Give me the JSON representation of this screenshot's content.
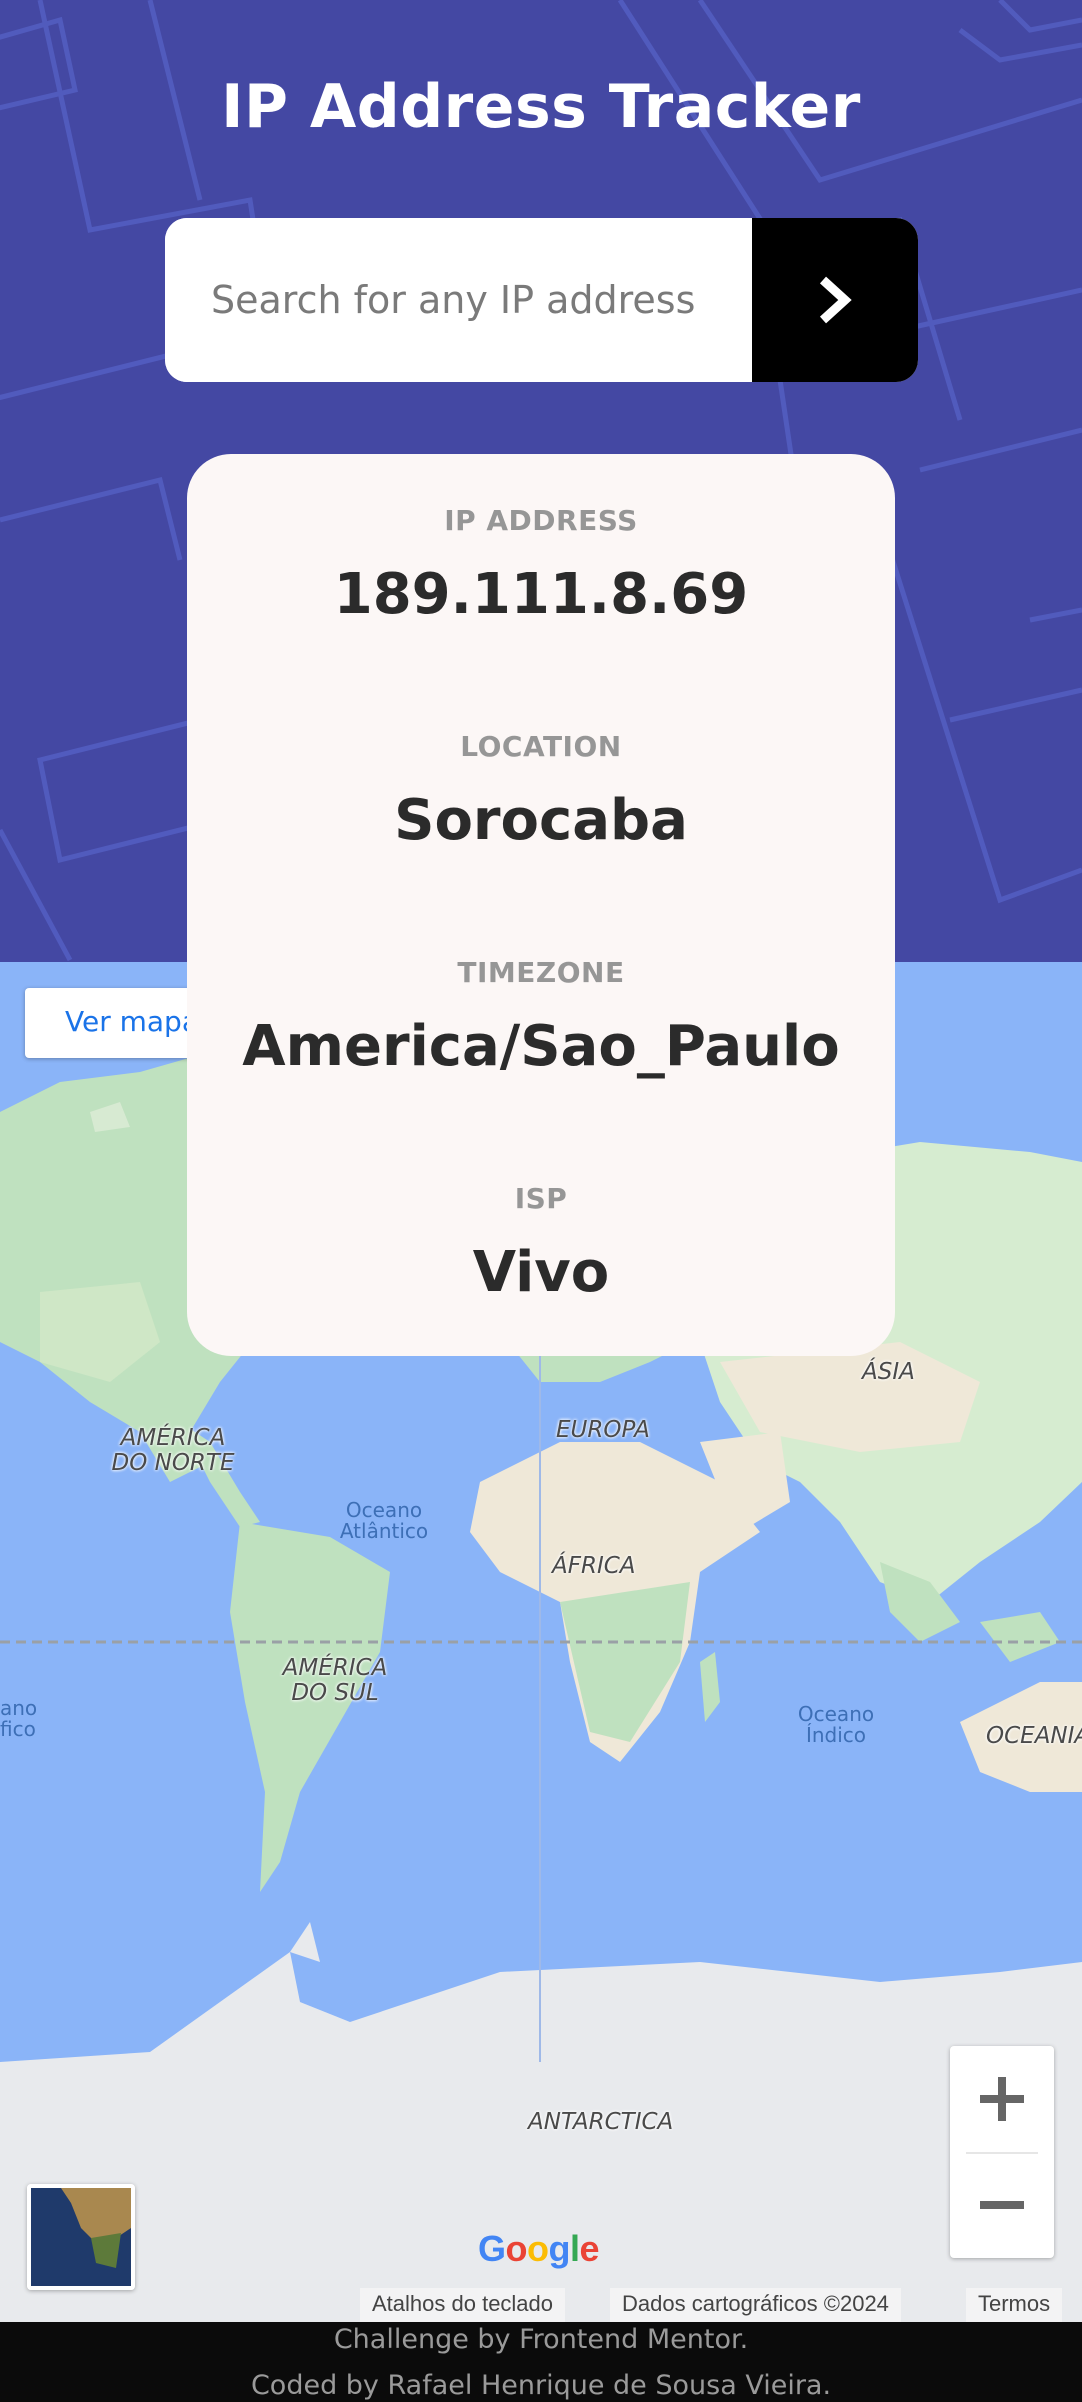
{
  "header": {
    "title": "IP Address Tracker"
  },
  "search": {
    "placeholder": "Search for any IP address",
    "submit_icon": "chevron-right-icon"
  },
  "info": {
    "ip_label": "IP ADDRESS",
    "ip_value": "189.111.8.69",
    "location_label": "LOCATION",
    "location_value": "Sorocaba",
    "timezone_label": "TIMEZONE",
    "timezone_value": "America/Sao_Paulo",
    "isp_label": "ISP",
    "isp_value": "Vivo"
  },
  "map": {
    "view_button": "Ver mapa",
    "labels": {
      "north_america": "AMÉRICA DO NORTE",
      "europe": "EUROPA",
      "asia": "ÁSIA",
      "africa": "ÁFRICA",
      "south_america": "AMÉRICA DO SUL",
      "oceania": "OCEANIA",
      "antarctica": "ANTARCTICA",
      "atlantic": "Oceano Atlântico",
      "indian": "Oceano Índico",
      "pacific_partial": "ano fico"
    },
    "google": "Google",
    "attribution": {
      "shortcuts": "Atalhos do teclado",
      "data": "Dados cartográficos ©2024",
      "terms": "Termos"
    },
    "zoom_in_icon": "plus-icon",
    "zoom_out_icon": "minus-icon"
  },
  "footer": {
    "line1": "Challenge by Frontend Mentor.",
    "line2": "Coded by Rafael Henrique de Sousa Vieira."
  },
  "colors": {
    "header_bg": "#4448a3",
    "map_water": "#8ab4f8",
    "land": "#bfe1bf",
    "card_bg": "#fcf7f6"
  }
}
